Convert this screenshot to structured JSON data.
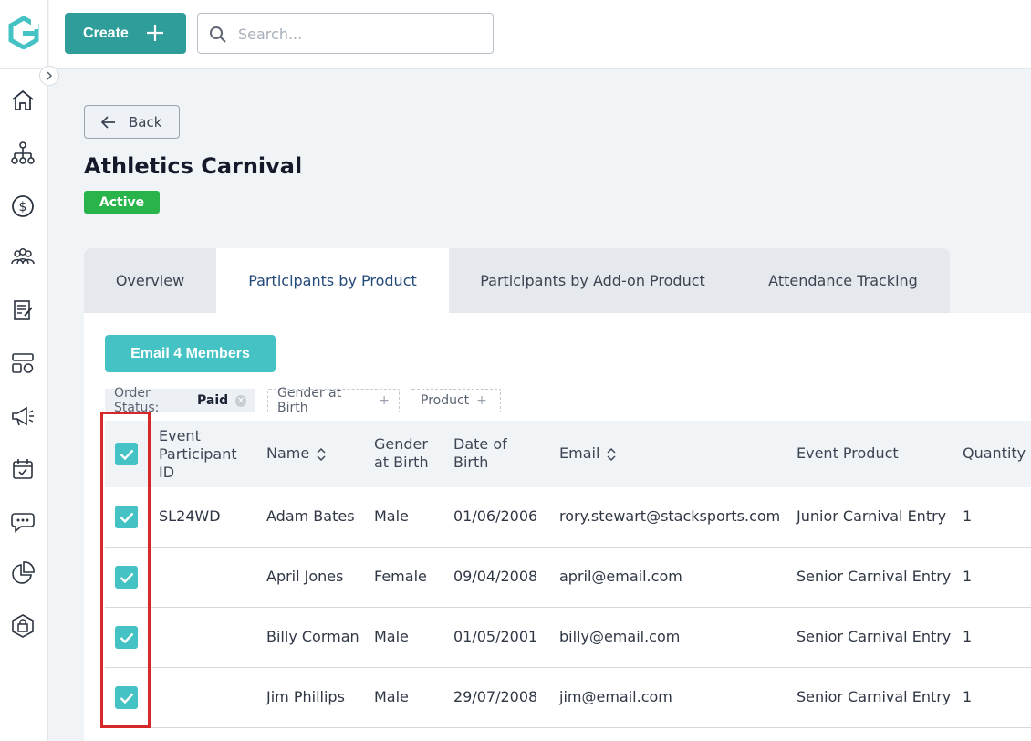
{
  "colors": {
    "brand_teal": "#2f9e9a",
    "accent_cyan": "#44c2c4",
    "active_green": "#28b34b",
    "highlight_red": "#d62828"
  },
  "sidebar": {
    "items": [
      {
        "icon": "home-icon"
      },
      {
        "icon": "org-chart-icon"
      },
      {
        "icon": "dollar-icon"
      },
      {
        "icon": "members-icon"
      },
      {
        "icon": "forms-icon"
      },
      {
        "icon": "programs-icon"
      },
      {
        "icon": "megaphone-icon"
      },
      {
        "icon": "calendar-icon"
      },
      {
        "icon": "chat-icon"
      },
      {
        "icon": "reports-icon"
      },
      {
        "icon": "shop-icon"
      }
    ]
  },
  "topbar": {
    "create_label": "Create",
    "search_placeholder": "Search..."
  },
  "page": {
    "back_label": "Back",
    "title": "Athletics Carnival",
    "status": "Active"
  },
  "tabs": [
    {
      "label": "Overview",
      "active": false
    },
    {
      "label": "Participants by Product",
      "active": true
    },
    {
      "label": "Participants by Add-on Product",
      "active": false
    },
    {
      "label": "Attendance Tracking",
      "active": false
    }
  ],
  "actions": {
    "email_label": "Email 4 Members"
  },
  "filters": {
    "order_status_label": "Order Status:",
    "order_status_value": "Paid",
    "gender_label": "Gender at Birth",
    "product_label": "Product"
  },
  "table": {
    "headers": {
      "participant_id": "Event Participant ID",
      "name": "Name",
      "gender": "Gender at Birth",
      "dob": "Date of Birth",
      "email": "Email",
      "event_product": "Event Product",
      "quantity": "Quantity"
    },
    "rows": [
      {
        "id": "SL24WD",
        "name": "Adam Bates",
        "gender": "Male",
        "dob": "01/06/2006",
        "email": "rory.stewart@stacksports.com",
        "product": "Junior Carnival Entry",
        "qty": "1"
      },
      {
        "id": "",
        "name": "April Jones",
        "gender": "Female",
        "dob": "09/04/2008",
        "email": "april@email.com",
        "product": "Senior Carnival Entry",
        "qty": "1"
      },
      {
        "id": "",
        "name": "Billy Corman",
        "gender": "Male",
        "dob": "01/05/2001",
        "email": "billy@email.com",
        "product": "Senior Carnival Entry",
        "qty": "1"
      },
      {
        "id": "",
        "name": "Jim Phillips",
        "gender": "Male",
        "dob": "29/07/2008",
        "email": "jim@email.com",
        "product": "Senior Carnival Entry",
        "qty": "1"
      }
    ]
  }
}
